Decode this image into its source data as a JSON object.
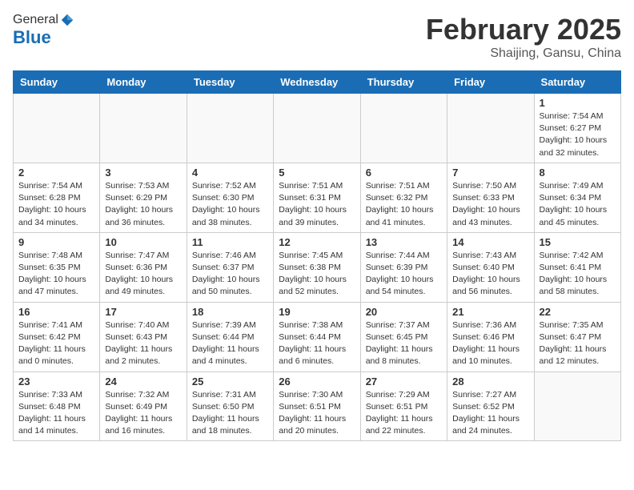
{
  "header": {
    "logo_general": "General",
    "logo_blue": "Blue",
    "month": "February 2025",
    "location": "Shaijing, Gansu, China"
  },
  "weekdays": [
    "Sunday",
    "Monday",
    "Tuesday",
    "Wednesday",
    "Thursday",
    "Friday",
    "Saturday"
  ],
  "weeks": [
    [
      {
        "day": "",
        "info": ""
      },
      {
        "day": "",
        "info": ""
      },
      {
        "day": "",
        "info": ""
      },
      {
        "day": "",
        "info": ""
      },
      {
        "day": "",
        "info": ""
      },
      {
        "day": "",
        "info": ""
      },
      {
        "day": "1",
        "info": "Sunrise: 7:54 AM\nSunset: 6:27 PM\nDaylight: 10 hours\nand 32 minutes."
      }
    ],
    [
      {
        "day": "2",
        "info": "Sunrise: 7:54 AM\nSunset: 6:28 PM\nDaylight: 10 hours\nand 34 minutes."
      },
      {
        "day": "3",
        "info": "Sunrise: 7:53 AM\nSunset: 6:29 PM\nDaylight: 10 hours\nand 36 minutes."
      },
      {
        "day": "4",
        "info": "Sunrise: 7:52 AM\nSunset: 6:30 PM\nDaylight: 10 hours\nand 38 minutes."
      },
      {
        "day": "5",
        "info": "Sunrise: 7:51 AM\nSunset: 6:31 PM\nDaylight: 10 hours\nand 39 minutes."
      },
      {
        "day": "6",
        "info": "Sunrise: 7:51 AM\nSunset: 6:32 PM\nDaylight: 10 hours\nand 41 minutes."
      },
      {
        "day": "7",
        "info": "Sunrise: 7:50 AM\nSunset: 6:33 PM\nDaylight: 10 hours\nand 43 minutes."
      },
      {
        "day": "8",
        "info": "Sunrise: 7:49 AM\nSunset: 6:34 PM\nDaylight: 10 hours\nand 45 minutes."
      }
    ],
    [
      {
        "day": "9",
        "info": "Sunrise: 7:48 AM\nSunset: 6:35 PM\nDaylight: 10 hours\nand 47 minutes."
      },
      {
        "day": "10",
        "info": "Sunrise: 7:47 AM\nSunset: 6:36 PM\nDaylight: 10 hours\nand 49 minutes."
      },
      {
        "day": "11",
        "info": "Sunrise: 7:46 AM\nSunset: 6:37 PM\nDaylight: 10 hours\nand 50 minutes."
      },
      {
        "day": "12",
        "info": "Sunrise: 7:45 AM\nSunset: 6:38 PM\nDaylight: 10 hours\nand 52 minutes."
      },
      {
        "day": "13",
        "info": "Sunrise: 7:44 AM\nSunset: 6:39 PM\nDaylight: 10 hours\nand 54 minutes."
      },
      {
        "day": "14",
        "info": "Sunrise: 7:43 AM\nSunset: 6:40 PM\nDaylight: 10 hours\nand 56 minutes."
      },
      {
        "day": "15",
        "info": "Sunrise: 7:42 AM\nSunset: 6:41 PM\nDaylight: 10 hours\nand 58 minutes."
      }
    ],
    [
      {
        "day": "16",
        "info": "Sunrise: 7:41 AM\nSunset: 6:42 PM\nDaylight: 11 hours\nand 0 minutes."
      },
      {
        "day": "17",
        "info": "Sunrise: 7:40 AM\nSunset: 6:43 PM\nDaylight: 11 hours\nand 2 minutes."
      },
      {
        "day": "18",
        "info": "Sunrise: 7:39 AM\nSunset: 6:44 PM\nDaylight: 11 hours\nand 4 minutes."
      },
      {
        "day": "19",
        "info": "Sunrise: 7:38 AM\nSunset: 6:44 PM\nDaylight: 11 hours\nand 6 minutes."
      },
      {
        "day": "20",
        "info": "Sunrise: 7:37 AM\nSunset: 6:45 PM\nDaylight: 11 hours\nand 8 minutes."
      },
      {
        "day": "21",
        "info": "Sunrise: 7:36 AM\nSunset: 6:46 PM\nDaylight: 11 hours\nand 10 minutes."
      },
      {
        "day": "22",
        "info": "Sunrise: 7:35 AM\nSunset: 6:47 PM\nDaylight: 11 hours\nand 12 minutes."
      }
    ],
    [
      {
        "day": "23",
        "info": "Sunrise: 7:33 AM\nSunset: 6:48 PM\nDaylight: 11 hours\nand 14 minutes."
      },
      {
        "day": "24",
        "info": "Sunrise: 7:32 AM\nSunset: 6:49 PM\nDaylight: 11 hours\nand 16 minutes."
      },
      {
        "day": "25",
        "info": "Sunrise: 7:31 AM\nSunset: 6:50 PM\nDaylight: 11 hours\nand 18 minutes."
      },
      {
        "day": "26",
        "info": "Sunrise: 7:30 AM\nSunset: 6:51 PM\nDaylight: 11 hours\nand 20 minutes."
      },
      {
        "day": "27",
        "info": "Sunrise: 7:29 AM\nSunset: 6:51 PM\nDaylight: 11 hours\nand 22 minutes."
      },
      {
        "day": "28",
        "info": "Sunrise: 7:27 AM\nSunset: 6:52 PM\nDaylight: 11 hours\nand 24 minutes."
      },
      {
        "day": "",
        "info": ""
      }
    ]
  ]
}
